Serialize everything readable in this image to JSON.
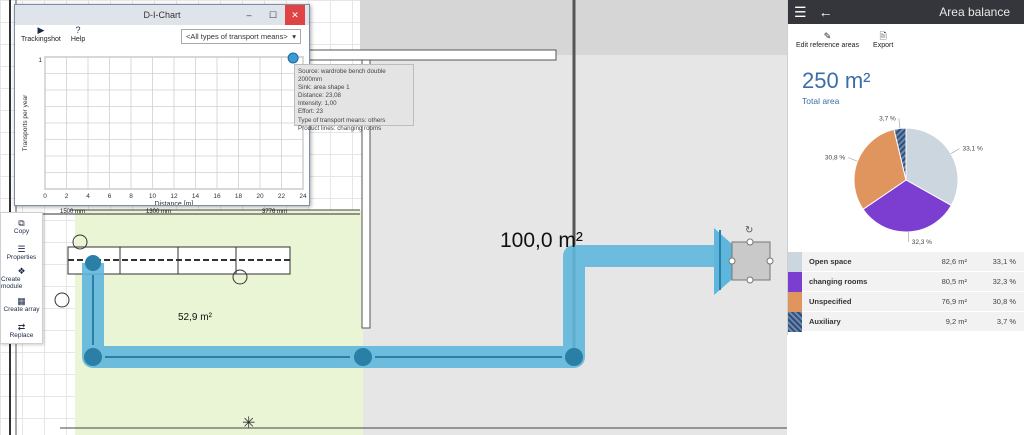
{
  "floor": {
    "area_big_label": "100,0 m²",
    "area_small_label": "52,9 m²",
    "dims": [
      "1500 mm",
      "1300 mm",
      "3776 mm"
    ],
    "colors": {
      "flow": "#5fb6dc",
      "node": "#2a7fa6",
      "green_zone": "#eaf5d6",
      "gray_zone": "#e8e8e8",
      "source": "#c8c8c8"
    }
  },
  "dichart": {
    "title": "D-I-Chart",
    "window_buttons": [
      "–",
      "☐",
      "✕"
    ],
    "toolbar": [
      {
        "label": "Trackingshot",
        "icon": "play-icon"
      },
      {
        "label": "Help",
        "icon": "help-icon"
      }
    ],
    "filter_value": "<All types of transport means>",
    "chart_data": {
      "type": "scatter",
      "xlabel": "Distance [m]",
      "ylabel": "Transports per year",
      "xticks": [
        0,
        2,
        4,
        6,
        8,
        10,
        12,
        14,
        16,
        18,
        20,
        22,
        24
      ],
      "yticks": [
        "1"
      ],
      "xlim": [
        0,
        24
      ],
      "points": [
        {
          "x": 23.08,
          "y": 1.0
        }
      ],
      "grid": true
    },
    "tooltip": [
      "Source: wardrobe bench double 2000mm",
      "Sink: area shape 1",
      "Distance: 23,08",
      "Intensity: 1,00",
      "Effort: 23",
      "Type of transport means: others",
      "Product lines: changing rooms"
    ]
  },
  "left_tools": [
    {
      "label": "Copy",
      "icon": "copy-icon"
    },
    {
      "label": "Properties",
      "icon": "properties-icon"
    },
    {
      "label": "Create module",
      "icon": "module-icon"
    },
    {
      "label": "Create array",
      "icon": "array-icon"
    },
    {
      "label": "Replace",
      "icon": "replace-icon"
    }
  ],
  "panel": {
    "title": "Area balance",
    "tools": [
      {
        "label": "Edit reference areas",
        "icon": "edit-icon"
      },
      {
        "label": "Export",
        "icon": "export-icon"
      }
    ],
    "total_value": "250 m²",
    "total_label": "Total area",
    "pie_labels": [
      "33,1 %",
      "32,3 %",
      "30,8 %",
      "3,7 %"
    ],
    "legend": [
      {
        "name": "Open space",
        "area": "82,6 m²",
        "percent": "33,1 %",
        "color": "#ccd6df",
        "value": 33.1
      },
      {
        "name": "changing rooms",
        "area": "80,5 m²",
        "percent": "32,3 %",
        "color": "#7b3ed0",
        "value": 32.3
      },
      {
        "name": "Unspecified",
        "area": "76,9 m²",
        "percent": "30,8 %",
        "color": "#e0955e",
        "value": 30.8
      },
      {
        "name": "Auxiliary",
        "area": "9,2 m²",
        "percent": "3,7 %",
        "color": "#2f4f7a",
        "value": 3.7
      }
    ]
  }
}
